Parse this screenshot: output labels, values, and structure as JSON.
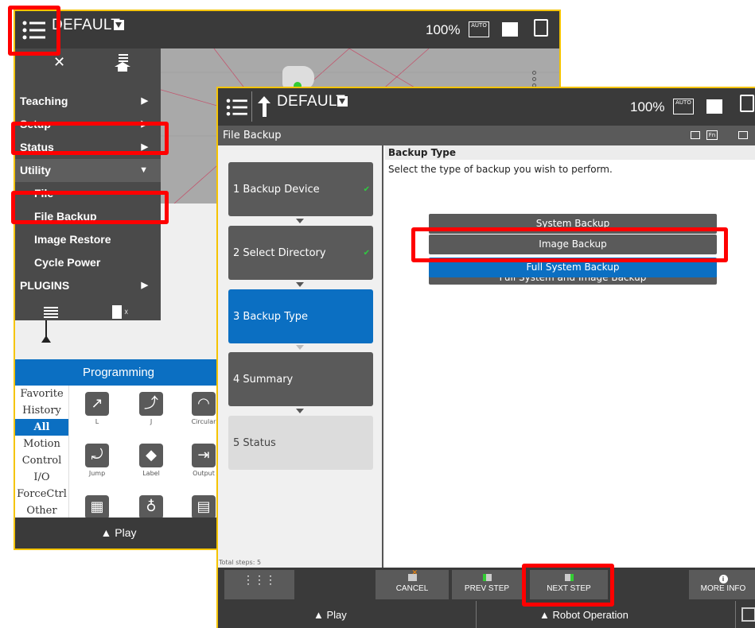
{
  "back_window": {
    "header": {
      "title": "DEFAULT",
      "zoom": "100%",
      "mode_icon_text": "AUTO"
    },
    "menu": {
      "items": [
        {
          "label": "Teaching",
          "has_submenu": true
        },
        {
          "label": "Setup",
          "has_submenu": true
        },
        {
          "label": "Status",
          "has_submenu": true
        },
        {
          "label": "Utility",
          "expanded": true
        },
        {
          "label": "File"
        },
        {
          "label": "File Backup"
        },
        {
          "label": "Image Restore"
        },
        {
          "label": "Cycle Power"
        },
        {
          "label": "PLUGINS",
          "has_submenu": true
        }
      ]
    },
    "programming_label": "Programming",
    "categories": [
      "Favorite",
      "History",
      "All",
      "Motion",
      "Control",
      "I/O",
      "ForceCtrl",
      "Other"
    ],
    "active_category": "All",
    "tools": [
      {
        "label": "L",
        "icon": "linear-move-icon"
      },
      {
        "label": "J",
        "icon": "joint-move-icon"
      },
      {
        "label": "Circular",
        "icon": "circular-move-icon"
      },
      {
        "label": "Jump",
        "icon": "jump-icon"
      },
      {
        "label": "Label",
        "icon": "label-tag-icon"
      },
      {
        "label": "Output",
        "icon": "output-icon"
      }
    ],
    "play_label": "▲ Play"
  },
  "front_window": {
    "header": {
      "title": "DEFAULT",
      "zoom": "100%",
      "mode_icon_text": "AUTO"
    },
    "page_title": "File Backup",
    "fn_label": "Fn",
    "steps": [
      {
        "label": "1  Backup Device",
        "state": "done"
      },
      {
        "label": "2  Select Directory",
        "state": "done"
      },
      {
        "label": "3  Backup Type",
        "state": "current"
      },
      {
        "label": "4  Summary",
        "state": "todo"
      },
      {
        "label": "5  Status",
        "state": "pending"
      }
    ],
    "total_steps": "Total steps: 5",
    "content": {
      "title": "Backup Type",
      "description": "Select the type of backup you wish to perform.",
      "options": [
        {
          "label": "System Backup",
          "selected": false
        },
        {
          "label": "Image Backup",
          "selected": false
        },
        {
          "label": "Full System Backup",
          "selected": true
        },
        {
          "label": "Full System and Image Backup",
          "selected": false
        }
      ]
    },
    "toolbar": {
      "cancel_label": "CANCEL",
      "prev_label": "PREV STEP",
      "next_label": "NEXT STEP",
      "info_label": "MORE INFO"
    },
    "play_label": "▲ Play",
    "robot_operation_label": "▲ Robot Operation"
  },
  "colors": {
    "accent": "#0b6fc2",
    "highlight": "#ff0000",
    "frame": "#f5c400",
    "dark_bar": "#3a3a3a"
  }
}
